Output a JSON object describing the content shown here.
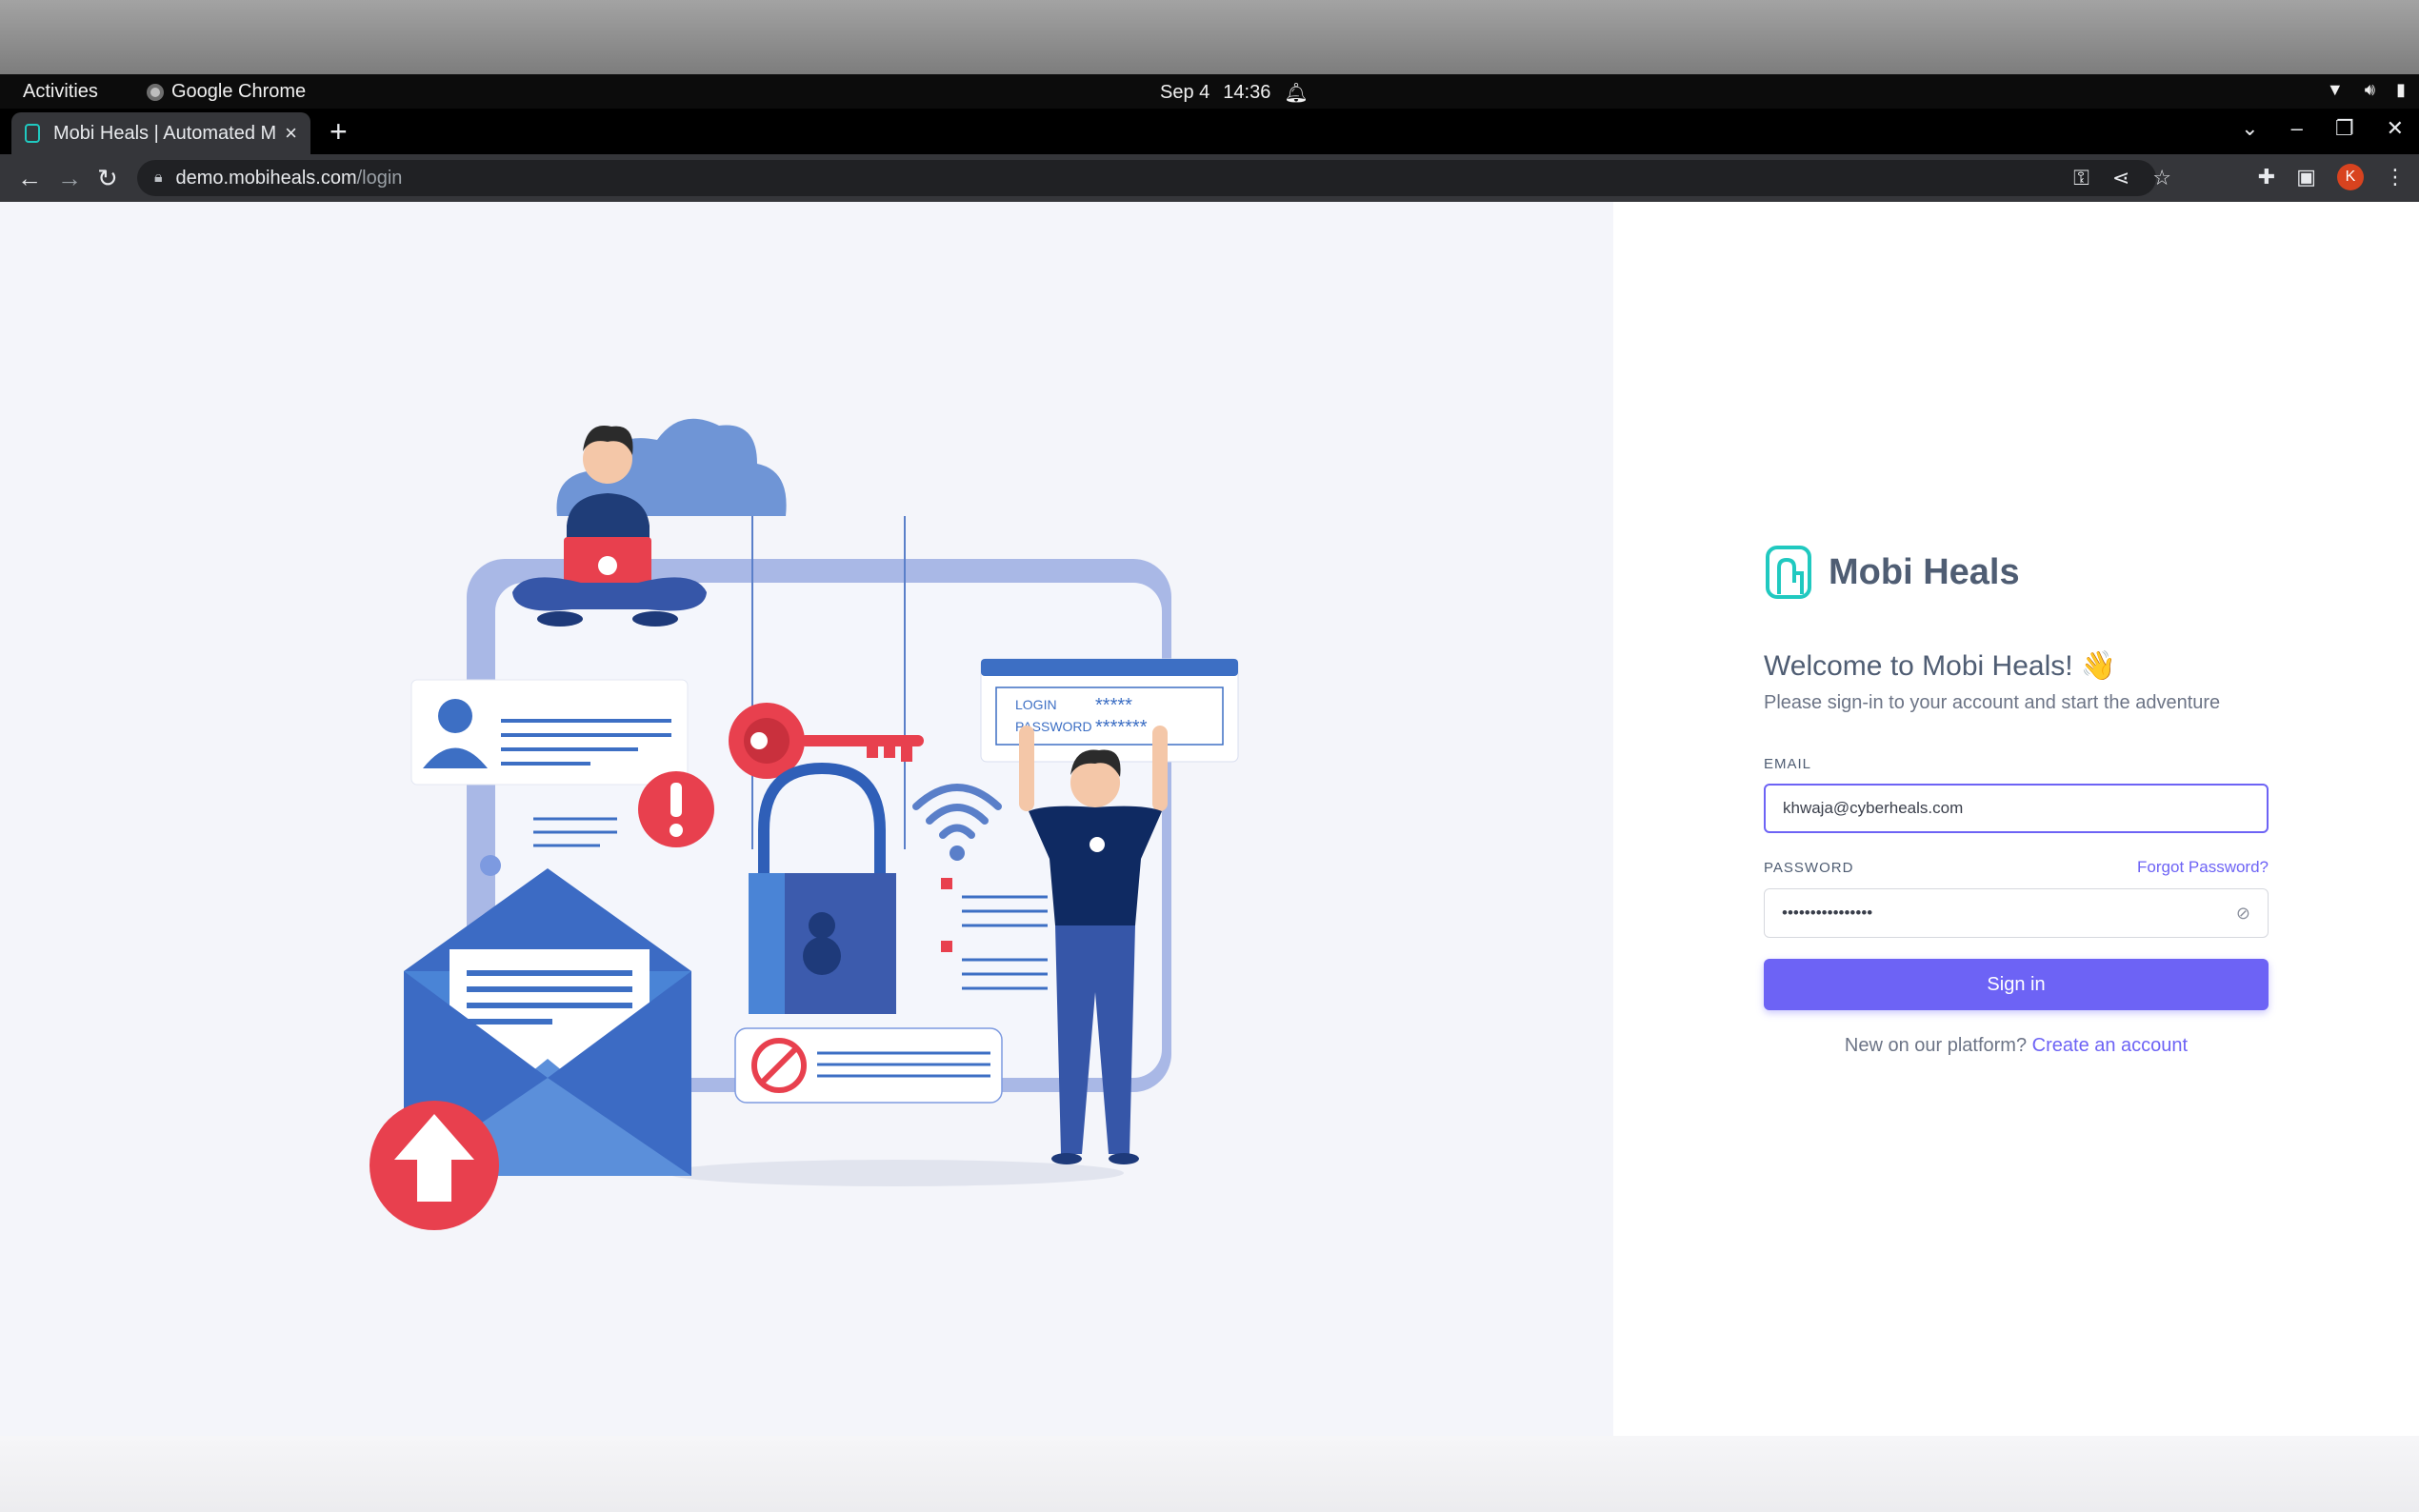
{
  "system_bar": {
    "activities": "Activities",
    "app_name": "Google Chrome",
    "date": "Sep 4",
    "time": "14:36"
  },
  "browser": {
    "tab_title": "Mobi Heals | Automated M",
    "url_host": "demo.mobiheals.com",
    "url_path": "/login",
    "profile_initial": "K"
  },
  "login": {
    "brand": "Mobi Heals",
    "welcome": "Welcome to Mobi Heals! 👋",
    "subtitle": "Please sign-in to your account and start the adventure",
    "email_label": "EMAIL",
    "email_value": "khwaja@cyberheals.com",
    "password_label": "PASSWORD",
    "forgot_password": "Forgot Password?",
    "password_value": "••••••••••••••••",
    "sign_in": "Sign in",
    "new_user_text": "New on our platform?",
    "create_account": "Create an account"
  },
  "illustration": {
    "login_text": "LOGIN",
    "login_stars": "*****",
    "password_text": "PASSWORD",
    "password_stars": "*******"
  },
  "colors": {
    "accent": "#6d63f5",
    "brand_teal": "#20c9c0",
    "illustration_red": "#e8404e",
    "illustration_blue": "#3d6fc4"
  }
}
